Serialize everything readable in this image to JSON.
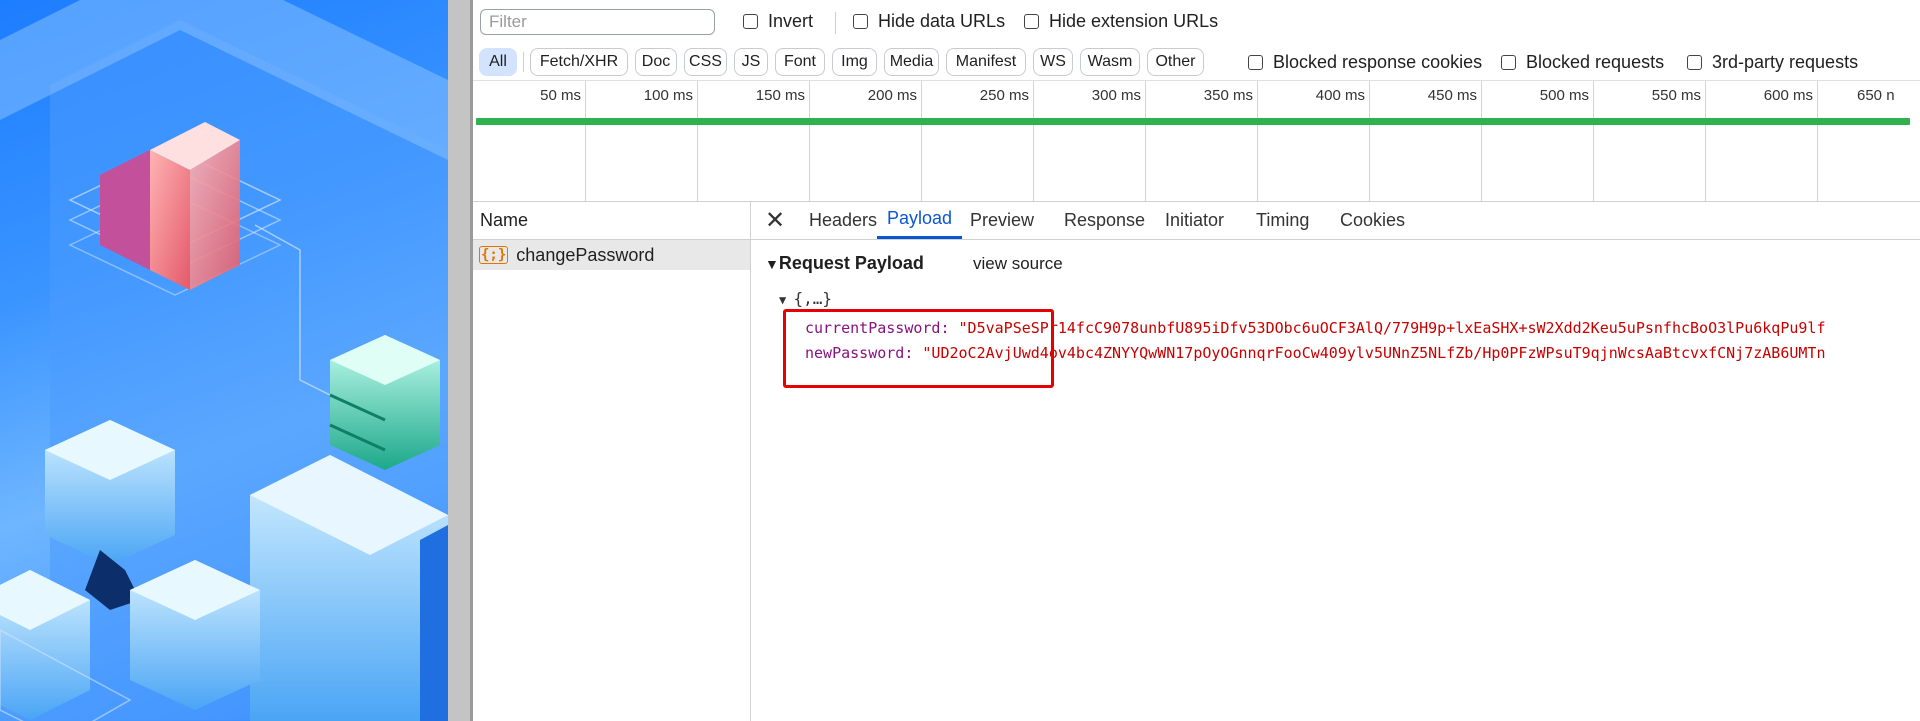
{
  "filter": {
    "placeholder": "Filter"
  },
  "options": {
    "invert": "Invert",
    "hide_data_urls": "Hide data URLs",
    "hide_extension_urls": "Hide extension URLs"
  },
  "type_filters": [
    "All",
    "Fetch/XHR",
    "Doc",
    "CSS",
    "JS",
    "Font",
    "Img",
    "Media",
    "Manifest",
    "WS",
    "Wasm",
    "Other"
  ],
  "extra_options": {
    "blocked_response_cookies": "Blocked response cookies",
    "blocked_requests": "Blocked requests",
    "third_party": "3rd-party requests"
  },
  "timeline": {
    "ticks": [
      "50 ms",
      "100 ms",
      "150 ms",
      "200 ms",
      "250 ms",
      "300 ms",
      "350 ms",
      "400 ms",
      "450 ms",
      "500 ms",
      "550 ms",
      "600 ms",
      "650 n"
    ]
  },
  "name_pane": {
    "header": "Name",
    "request": "changePassword",
    "request_icon": "{;}"
  },
  "tabs": {
    "close": "✕",
    "items": [
      "Headers",
      "Payload",
      "Preview",
      "Response",
      "Initiator",
      "Timing",
      "Cookies"
    ],
    "active": "Payload"
  },
  "payload": {
    "title": "Request Payload",
    "view_source": "view source",
    "object": "{,…}",
    "current_key": "currentPassword:",
    "current_value": "\"D5vaPSeSPr14fcC9078unbfU895iDfv53DObc6uOCF3AlQ/779H9p+lxEaSHX+sW2Xdd2Keu5uPsnfhcBoO3lPu6kqPu9lf",
    "new_key": "newPassword:",
    "new_value": "\"UD2oC2AvjUwd4ov4bc4ZNYYQwWN17pOyOGnnqrFooCw409ylv5UNnZ5NLfZb/Hp0PFzWPsuT9qjnWcsAaBtcvxfCNj7zAB6UMTn"
  },
  "colors": {
    "accent": "#0b57d0",
    "timeline_bar": "#2fb14e",
    "highlight": "#e60000"
  }
}
